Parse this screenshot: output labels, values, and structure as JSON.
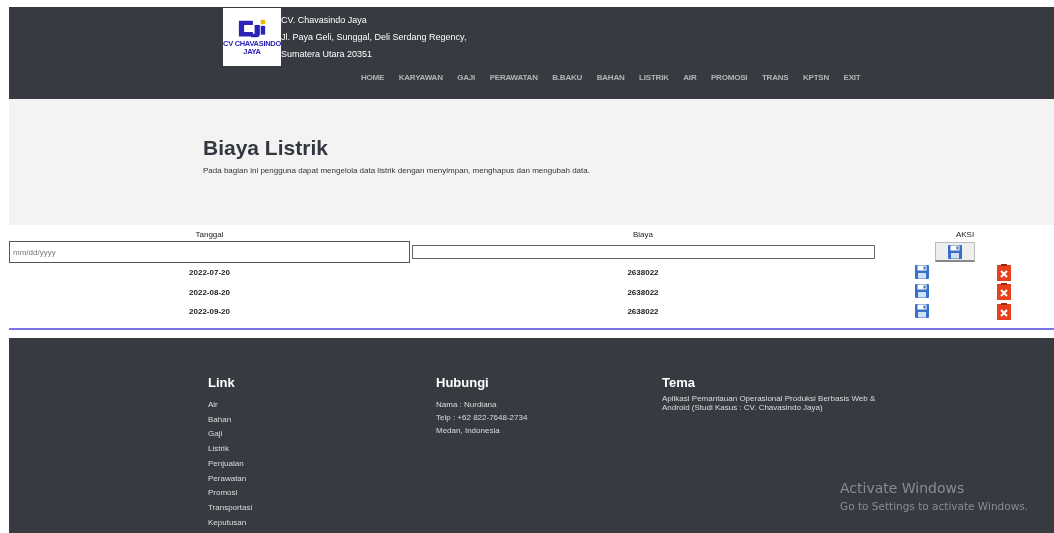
{
  "header": {
    "logo_text": "CV CHAVASINDO JAYA",
    "company": [
      "CV. Chavasindo Jaya",
      "Jl. Paya Geli, Sunggal, Deli Serdang Regency,",
      "Sumatera Utara 20351"
    ],
    "nav": [
      "HOME",
      "KARYAWAN",
      "GAJI",
      "PERAWATAN",
      "B.BAKU",
      "BAHAN",
      "LISTRIK",
      "AIR",
      "PROMOSI",
      "TRANS",
      "KPTSN",
      "EXIT"
    ]
  },
  "hero": {
    "title": "Biaya Listrik",
    "description": "Pada bagian ini pengguna dapat mengelola data listrik dengan menyimpan, menghapus dan mengubah data."
  },
  "table": {
    "columns": [
      "Tanggal",
      "Biaya",
      "AKSI"
    ],
    "form": {
      "date_placeholder": "mm/dd/yyyy"
    },
    "rows": [
      {
        "tanggal": "2022-07-20",
        "biaya": "2638022"
      },
      {
        "tanggal": "2022-08-20",
        "biaya": "2638022"
      },
      {
        "tanggal": "2022-09-20",
        "biaya": "2638022"
      }
    ]
  },
  "footer": {
    "link": {
      "title": "Link",
      "items": [
        "Air",
        "Bahan",
        "Gaji",
        "Listrik",
        "Penjualan",
        "Perawatan",
        "Promosi",
        "Transportasi",
        "Keputusan"
      ]
    },
    "hubungi": {
      "title": "Hubungi",
      "lines": [
        "Nama : Nurdiana",
        "Telp : +62 822-7648-2734",
        "Medan, Indonesia"
      ]
    },
    "tema": {
      "title": "Tema",
      "text": "Aplikasi Pemantauan Operasional Produksi Berbasis Web & Android (Studi Kasus : CV. Chavasindo Jaya)"
    }
  },
  "watermark": {
    "title": "Activate Windows",
    "subtitle": "Go to Settings to activate Windows."
  }
}
